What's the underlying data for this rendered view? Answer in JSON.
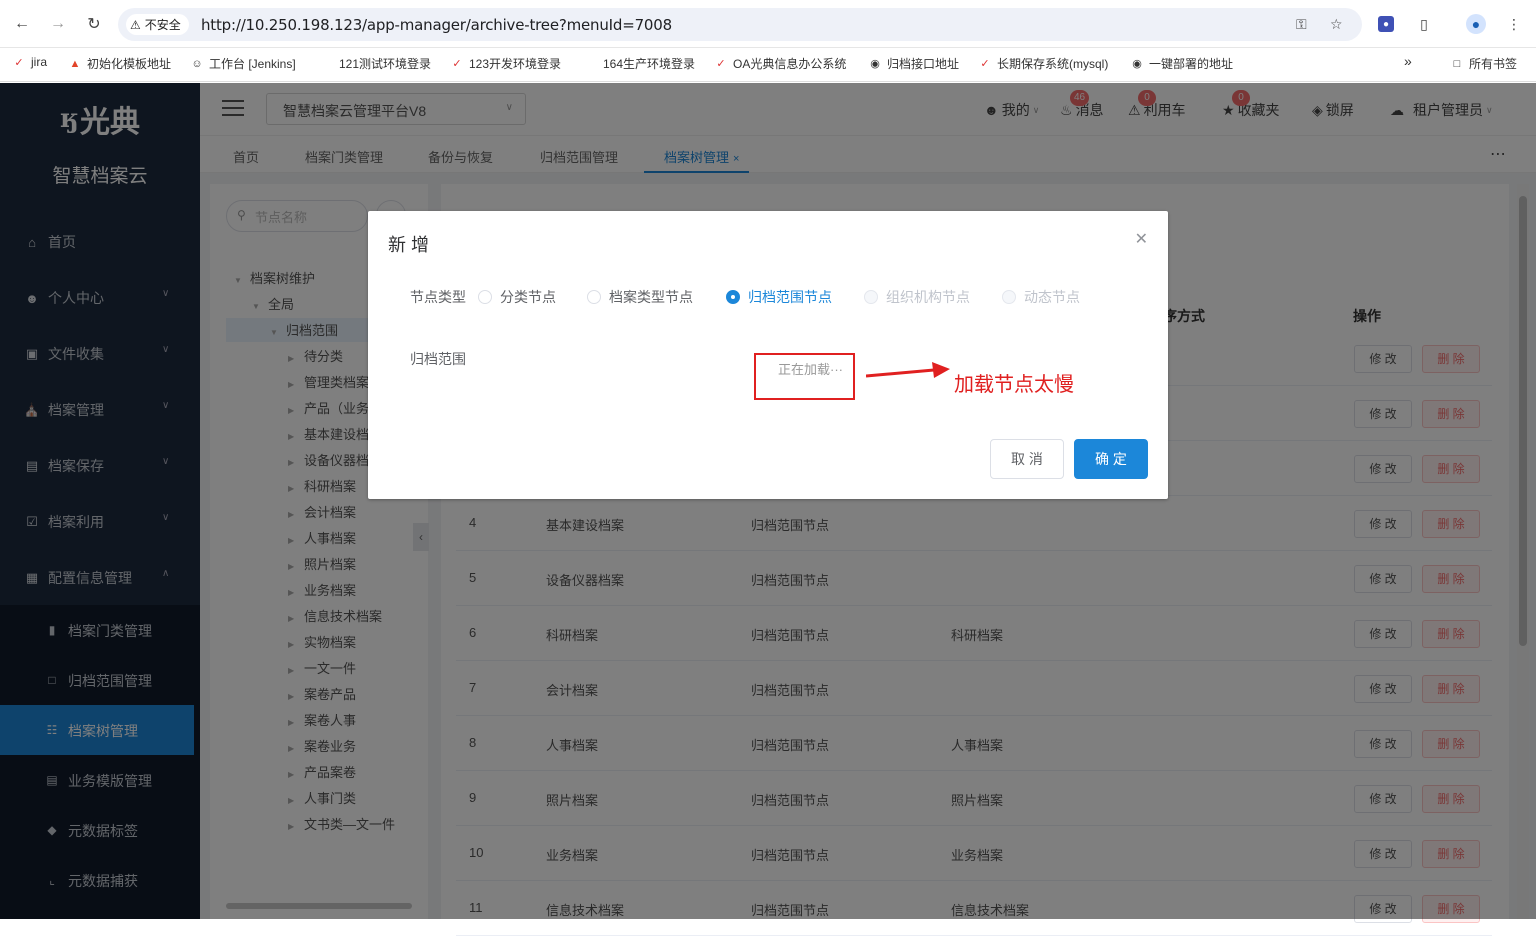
{
  "browser": {
    "security_label": "不安全",
    "url": "http://10.250.198.123/app-manager/archive-tree?menuId=7008",
    "bookmarks": [
      "jira",
      "初始化模板地址",
      "工作台 [Jenkins]",
      "121测试环境登录",
      "123开发环境登录",
      "164生产环境登录",
      "OA光典信息办公系统",
      "归档接口地址",
      "长期保存系统(mysql)",
      "一键部署的地址"
    ],
    "bookmarks_overflow": "»",
    "all_bookmarks": "所有书签"
  },
  "sidebar": {
    "logo_text": "光典",
    "product_name": "智慧档案云",
    "menu": [
      {
        "label": "首页",
        "icon": "home-icon"
      },
      {
        "label": "个人中心",
        "icon": "user-icon"
      },
      {
        "label": "文件收集",
        "icon": "folder-icon"
      },
      {
        "label": "档案管理",
        "icon": "bank-icon"
      },
      {
        "label": "档案保存",
        "icon": "save-icon"
      },
      {
        "label": "档案利用",
        "icon": "checklist-icon"
      },
      {
        "label": "配置信息管理",
        "icon": "settings-icon"
      }
    ],
    "submenu": [
      {
        "label": "档案门类管理",
        "icon": "library-icon"
      },
      {
        "label": "归档范围管理",
        "icon": "document-icon"
      },
      {
        "label": "档案树管理",
        "icon": "tree-icon"
      },
      {
        "label": "业务模版管理",
        "icon": "template-icon"
      },
      {
        "label": "元数据标签",
        "icon": "tag-icon"
      },
      {
        "label": "元数据捕获",
        "icon": "crop-icon"
      }
    ]
  },
  "header": {
    "system_select": "智慧档案云管理平台V8",
    "mine": "我的",
    "messages": "消息",
    "messages_count": "46",
    "cart": "利用车",
    "cart_count": "0",
    "favorites": "收藏夹",
    "favorites_count": "0",
    "lock": "锁屏",
    "tenant": "租户管理员"
  },
  "tabs": [
    "首页",
    "档案门类管理",
    "备份与恢复",
    "归档范围管理",
    "档案树管理"
  ],
  "tree": {
    "search_placeholder": "节点名称",
    "root": "档案树维护",
    "level1": "全局",
    "level2": "归档范围",
    "children": [
      "待分类",
      "管理类档案",
      "产品（业务",
      "基本建设档",
      "设备仪器档",
      "科研档案",
      "会计档案",
      "人事档案",
      "照片档案",
      "业务档案",
      "信息技术档案",
      "实物档案",
      "一文一件",
      "案卷产品",
      "案卷人事",
      "案卷业务",
      "产品案卷",
      "人事门类",
      "文书类—文一件"
    ]
  },
  "table": {
    "headers": {
      "sort": "序方式",
      "action": "操作"
    },
    "edit_label": "修 改",
    "delete_label": "删 除",
    "rows": [
      {
        "no": "",
        "name": "",
        "type": "",
        "category": ""
      },
      {
        "no": "",
        "name": "",
        "type": "",
        "category": ""
      },
      {
        "no": "",
        "name": "",
        "type": "",
        "category": ""
      },
      {
        "no": "4",
        "name": "基本建设档案",
        "type": "归档范围节点",
        "category": ""
      },
      {
        "no": "5",
        "name": "设备仪器档案",
        "type": "归档范围节点",
        "category": ""
      },
      {
        "no": "6",
        "name": "科研档案",
        "type": "归档范围节点",
        "category": "科研档案"
      },
      {
        "no": "7",
        "name": "会计档案",
        "type": "归档范围节点",
        "category": ""
      },
      {
        "no": "8",
        "name": "人事档案",
        "type": "归档范围节点",
        "category": "人事档案"
      },
      {
        "no": "9",
        "name": "照片档案",
        "type": "归档范围节点",
        "category": "照片档案"
      },
      {
        "no": "10",
        "name": "业务档案",
        "type": "归档范围节点",
        "category": "业务档案"
      },
      {
        "no": "11",
        "name": "信息技术档案",
        "type": "归档范围节点",
        "category": "信息技术档案"
      }
    ]
  },
  "dialog": {
    "title": "新 增",
    "node_type_label": "节点类型",
    "options": [
      {
        "label": "分类节点",
        "state": "off"
      },
      {
        "label": "档案类型节点",
        "state": "off"
      },
      {
        "label": "归档范围节点",
        "state": "on"
      },
      {
        "label": "组织机构节点",
        "state": "disabled"
      },
      {
        "label": "动态节点",
        "state": "disabled"
      }
    ],
    "scope_label": "归档范围",
    "loading_text": "正在加载···",
    "cancel": "取 消",
    "confirm": "确 定"
  },
  "annotation": {
    "text": "加载节点太慢",
    "color": "#e02020"
  },
  "colors": {
    "accent": "#1c87d9",
    "sidebar": "#1d2b3f",
    "danger": "#f56c6c"
  }
}
